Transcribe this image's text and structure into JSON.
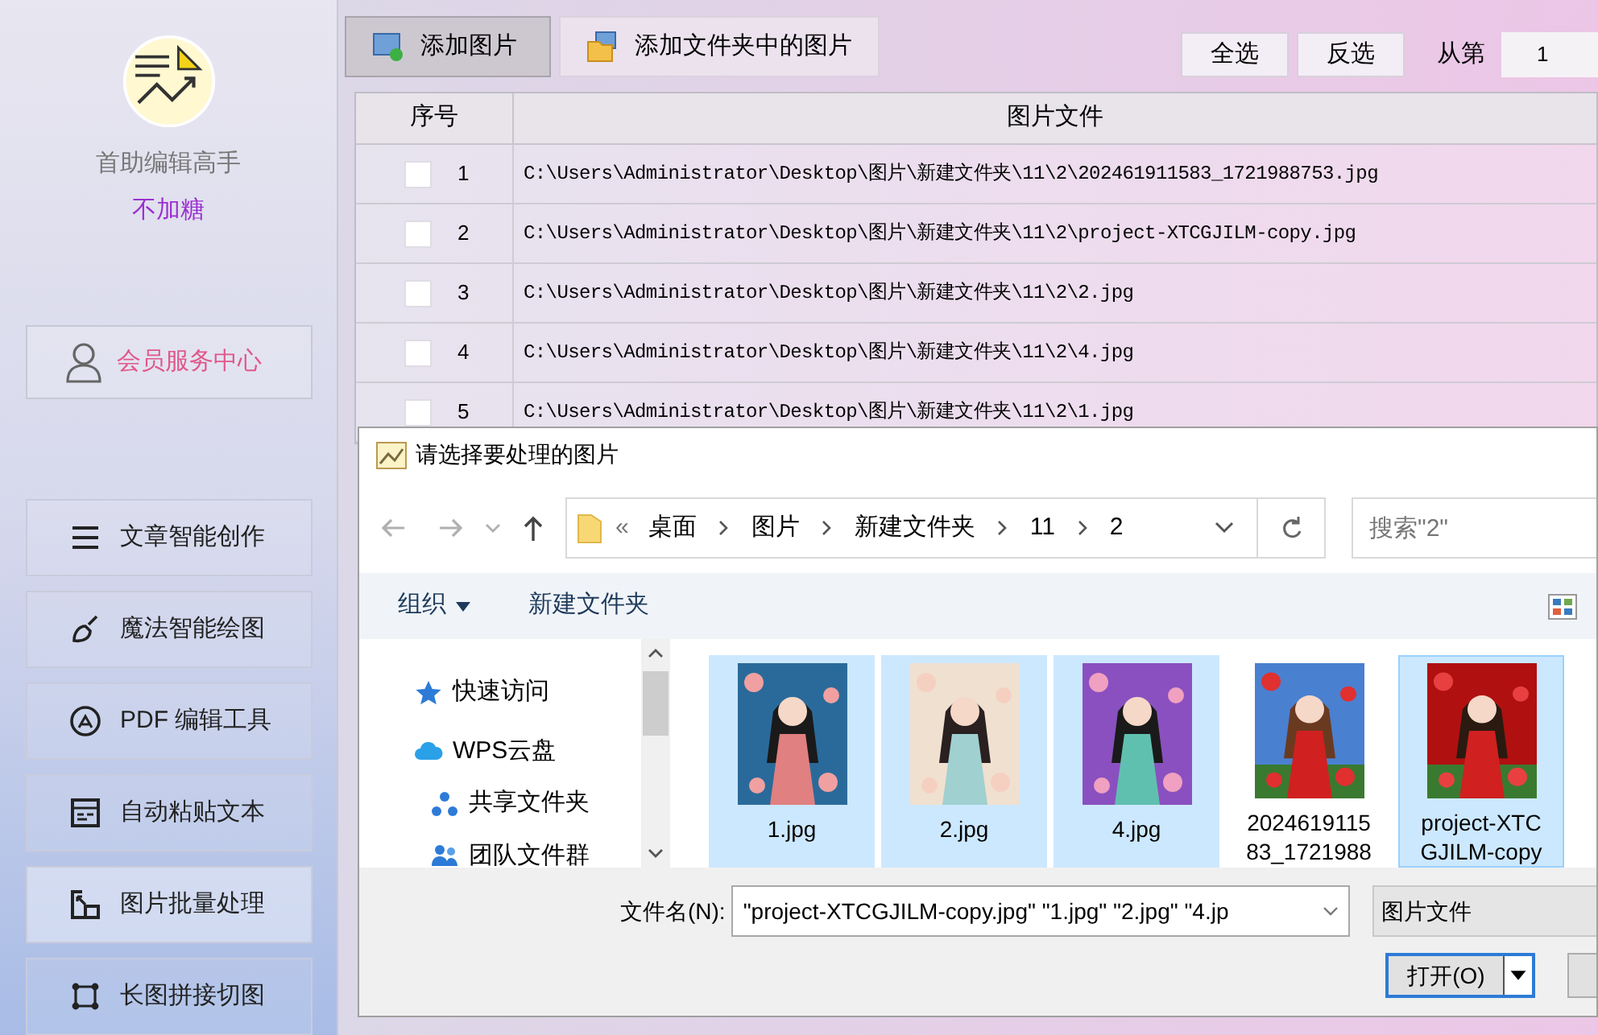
{
  "app": {
    "name": "首助编辑高手",
    "user": "不加糖"
  },
  "member_button": "会员服务中心",
  "sidebar": {
    "items": [
      {
        "label": "文章智能创作",
        "selected": false
      },
      {
        "label": "魔法智能绘图",
        "selected": false
      },
      {
        "label": "PDF 编辑工具",
        "selected": false
      },
      {
        "label": "自动粘贴文本",
        "selected": false
      },
      {
        "label": "图片批量处理",
        "selected": true
      },
      {
        "label": "长图拼接切图",
        "selected": false
      }
    ]
  },
  "toolbar": {
    "buttons": [
      {
        "label": "添加图片",
        "selected": true
      },
      {
        "label": "添加文件夹中的图片",
        "selected": false
      }
    ],
    "select_all": "全选",
    "invert": "反选",
    "from_label": "从第",
    "from_value": "1"
  },
  "table": {
    "columns": [
      "序号",
      "图片文件"
    ],
    "rows": [
      {
        "index": "1",
        "checked": false,
        "path": "C:\\Users\\Administrator\\Desktop\\图片\\新建文件夹\\11\\2\\202461911583_1721988753.jpg"
      },
      {
        "index": "2",
        "checked": false,
        "path": "C:\\Users\\Administrator\\Desktop\\图片\\新建文件夹\\11\\2\\project-XTCGJILM-copy.jpg"
      },
      {
        "index": "3",
        "checked": false,
        "path": "C:\\Users\\Administrator\\Desktop\\图片\\新建文件夹\\11\\2\\2.jpg"
      },
      {
        "index": "4",
        "checked": false,
        "path": "C:\\Users\\Administrator\\Desktop\\图片\\新建文件夹\\11\\2\\4.jpg"
      },
      {
        "index": "5",
        "checked": false,
        "path": "C:\\Users\\Administrator\\Desktop\\图片\\新建文件夹\\11\\2\\1.jpg"
      }
    ]
  },
  "dialog": {
    "title": "请选择要处理的图片",
    "breadcrumb": [
      "«",
      "桌面",
      "图片",
      "新建文件夹",
      "11",
      "2"
    ],
    "search_placeholder": "搜索\"2\"",
    "commands": {
      "organize": "组织",
      "new_folder": "新建文件夹"
    },
    "nav": [
      {
        "label": "快速访问"
      },
      {
        "label": "WPS云盘"
      },
      {
        "label": "共享文件夹"
      },
      {
        "label": "团队文件群"
      }
    ],
    "files": [
      {
        "name": "1.jpg",
        "selected": true,
        "focused": false,
        "kind": "picture"
      },
      {
        "name": "2.jpg",
        "selected": true,
        "focused": false,
        "kind": "picture"
      },
      {
        "name": "4.jpg",
        "selected": true,
        "focused": false,
        "kind": "picture"
      },
      {
        "name": "2024619115 83_1721988",
        "selected": false,
        "focused": false,
        "kind": "picture"
      },
      {
        "name": "project-XTC GJILM-copy",
        "selected": true,
        "focused": true,
        "kind": "picture"
      }
    ],
    "filename_label": "文件名(N):",
    "filename_value": "\"project-XTCGJILM-copy.jpg\" \"1.jpg\" \"2.jpg\" \"4.jp",
    "filetype": "图片文件",
    "open_button": "打开(O)"
  }
}
